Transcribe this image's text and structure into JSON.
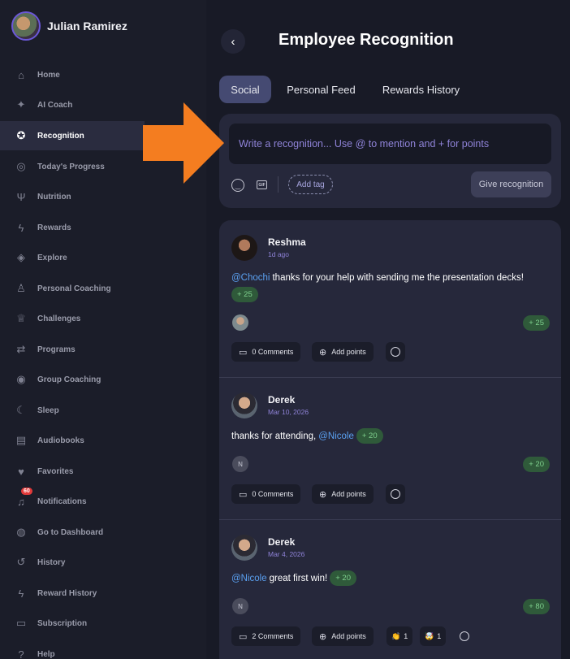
{
  "user": {
    "name": "Julian Ramirez"
  },
  "sidebar": {
    "items": [
      {
        "label": "Home",
        "icon": "home-icon",
        "glyph": "⌂",
        "active": false
      },
      {
        "label": "AI Coach",
        "icon": "sparkle-icon",
        "glyph": "✦",
        "active": false
      },
      {
        "label": "Recognition",
        "icon": "award-icon",
        "glyph": "✪",
        "active": true
      },
      {
        "label": "Today's Progress",
        "icon": "target-icon",
        "glyph": "◎",
        "active": false
      },
      {
        "label": "Nutrition",
        "icon": "utensils-icon",
        "glyph": "Ψ",
        "active": false
      },
      {
        "label": "Rewards",
        "icon": "bolt-icon",
        "glyph": "ϟ",
        "active": false
      },
      {
        "label": "Explore",
        "icon": "compass-icon",
        "glyph": "◈",
        "active": false
      },
      {
        "label": "Personal Coaching",
        "icon": "coach-icon",
        "glyph": "♙",
        "active": false
      },
      {
        "label": "Challenges",
        "icon": "trophy-icon",
        "glyph": "♕",
        "active": false
      },
      {
        "label": "Programs",
        "icon": "route-icon",
        "glyph": "⇄",
        "active": false
      },
      {
        "label": "Group Coaching",
        "icon": "broadcast-icon",
        "glyph": "◉",
        "active": false
      },
      {
        "label": "Sleep",
        "icon": "moon-icon",
        "glyph": "☾",
        "active": false
      },
      {
        "label": "Audiobooks",
        "icon": "book-icon",
        "glyph": "▤",
        "active": false
      },
      {
        "label": "Favorites",
        "icon": "heart-icon",
        "glyph": "♥",
        "active": false
      },
      {
        "label": "Notifications",
        "icon": "bell-icon",
        "glyph": "♫",
        "active": false,
        "badge": "60"
      },
      {
        "label": "Go to Dashboard",
        "icon": "dashboard-icon",
        "glyph": "◍",
        "active": false
      },
      {
        "label": "History",
        "icon": "history-icon",
        "glyph": "↺",
        "active": false
      },
      {
        "label": "Reward History",
        "icon": "bolt-icon",
        "glyph": "ϟ",
        "active": false
      },
      {
        "label": "Subscription",
        "icon": "card-icon",
        "glyph": "▭",
        "active": false
      },
      {
        "label": "Help",
        "icon": "help-icon",
        "glyph": "?",
        "active": false
      }
    ]
  },
  "header": {
    "back": "‹",
    "title": "Employee Recognition"
  },
  "tabs": [
    {
      "label": "Social",
      "active": true
    },
    {
      "label": "Personal Feed",
      "active": false
    },
    {
      "label": "Rewards History",
      "active": false
    }
  ],
  "composer": {
    "placeholder": "Write a recognition... Use @ to mention and + for points",
    "gif": "GIF",
    "add_tag": "Add tag",
    "give": "Give recognition"
  },
  "posts": [
    {
      "author": "Reshma",
      "date": "1d ago",
      "mention": "@Chochi",
      "text": "thanks for your help with sending me the presentation decks!",
      "points": "+ 25",
      "total": "+ 25",
      "comments": "0 Comments",
      "add_points": "Add points"
    },
    {
      "author": "Derek",
      "date": "Mar 10, 2026",
      "text": "thanks for attending,",
      "mention": "@Nicole",
      "points": "+ 20",
      "recipient_initial": "N",
      "total": "+ 20",
      "comments": "0 Comments",
      "add_points": "Add points"
    },
    {
      "author": "Derek",
      "date": "Mar 4, 2026",
      "mention": "@Nicole",
      "text": "great first win!",
      "points": "+ 20",
      "recipient_initial": "N",
      "total": "+ 80",
      "comments": "2 Comments",
      "add_points": "Add points",
      "reactions": [
        {
          "emoji": "👏",
          "count": "1"
        },
        {
          "emoji": "🤯",
          "count": "1"
        }
      ]
    }
  ],
  "colors": {
    "accent": "#454a72",
    "mention": "#5aa0f0",
    "points_bg": "#2f5a3a",
    "arrow": "#f47d20"
  }
}
